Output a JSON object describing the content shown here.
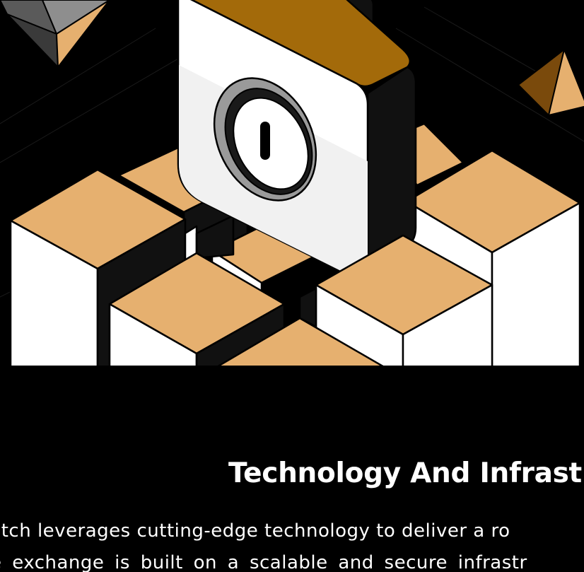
{
  "colors": {
    "background": "#000000",
    "accent": "#e6b06f",
    "accent_dark": "#a36a0a",
    "text": "#ffffff"
  },
  "hero": {
    "icon": "padlock-on-blocks-illustration"
  },
  "section": {
    "title": "Technology And Infrast",
    "body_lines": [
      "itch leverages cutting-edge technology to deliver a ro",
      "e exchange is built on a scalable and secure infrastr"
    ]
  }
}
